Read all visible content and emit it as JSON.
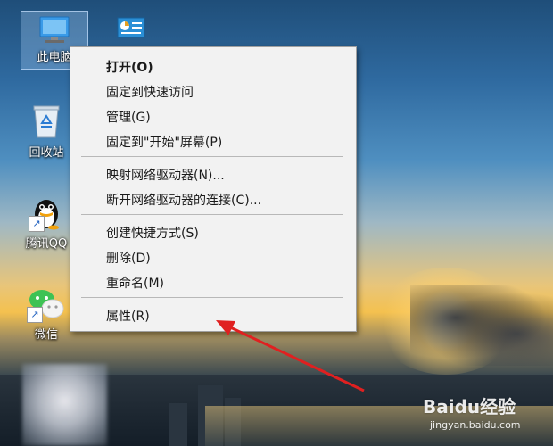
{
  "desktop": {
    "icons": [
      {
        "label": "此电脑",
        "icon": "computer-icon"
      },
      {
        "label": "",
        "icon": "control-panel-icon"
      },
      {
        "label": "回收站",
        "icon": "recycle-bin-icon"
      },
      {
        "label": "腾讯QQ",
        "icon": "qq-penguin-icon"
      },
      {
        "label": "微信",
        "icon": "wechat-icon"
      }
    ]
  },
  "context_menu": {
    "items": [
      {
        "label": "打开(O)",
        "bold": true
      },
      {
        "label": "固定到快速访问"
      },
      {
        "label": "管理(G)"
      },
      {
        "label": "固定到\"开始\"屏幕(P)"
      },
      {
        "label": "映射网络驱动器(N)..."
      },
      {
        "label": "断开网络驱动器的连接(C)..."
      },
      {
        "label": "创建快捷方式(S)"
      },
      {
        "label": "删除(D)"
      },
      {
        "label": "重命名(M)"
      },
      {
        "label": "属性(R)"
      }
    ]
  },
  "annotation": {
    "arrow_color": "#e02020"
  },
  "watermark": {
    "text": "Baidu经验",
    "url": "jingyan.baidu.com"
  }
}
